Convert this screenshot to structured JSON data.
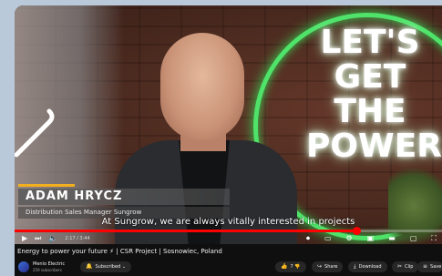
{
  "video": {
    "neon_sign": [
      "LET'S",
      "GET",
      "THE",
      "POWER"
    ],
    "lower_third": {
      "name": "ADAM HRYCZ",
      "role": "Distribution Sales Manager Sungrow"
    },
    "subtitle": "At Sungrow, we are always vitally interested in projects",
    "progress_fraction": 0.8,
    "time": "2:17 / 3:44"
  },
  "info": {
    "title": "Energy to power your future ⚡ | CSR Project | Sosnowiec, Poland",
    "channel_name": "Menlo Electric",
    "channel_subs": "259 subscribers",
    "subscribed_label": "Subscribed",
    "like_count": "7",
    "share_label": "Share",
    "download_label": "Download",
    "clip_label": "Clip",
    "save_label": "Save"
  },
  "colors": {
    "accent": "#f2b01e",
    "progress": "#ff0000",
    "neon": "#4fe36a"
  }
}
